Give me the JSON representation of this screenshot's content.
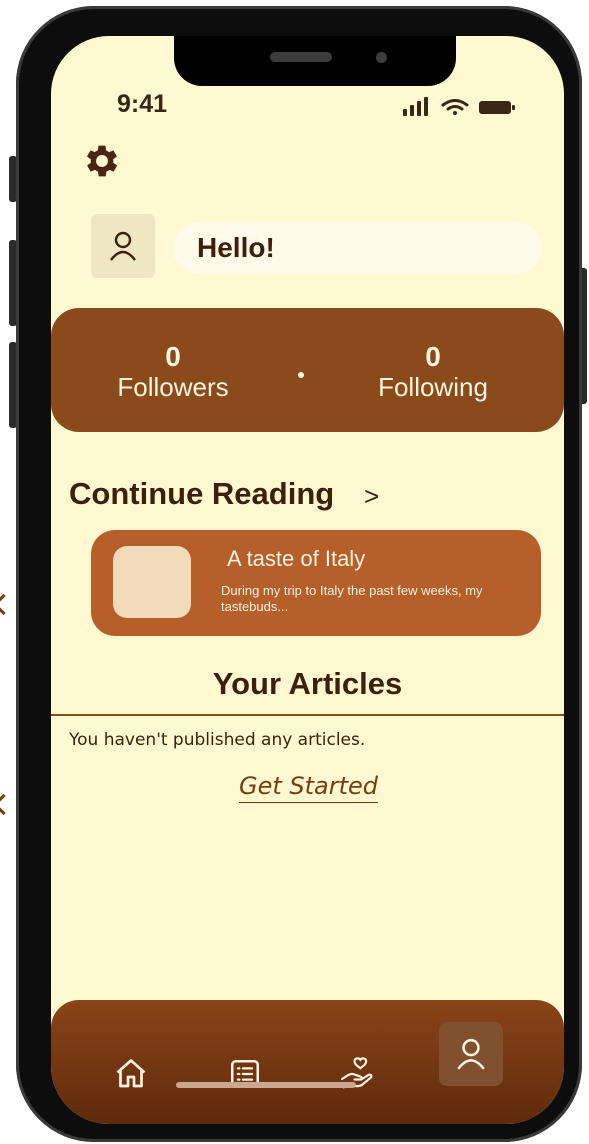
{
  "status_bar": {
    "time": "9:41"
  },
  "profile": {
    "greeting": "Hello!"
  },
  "stats": {
    "followers": {
      "count": "0",
      "label": "Followers"
    },
    "following": {
      "count": "0",
      "label": "Following"
    }
  },
  "continue_reading": {
    "title": "Continue Reading",
    "chevron": ">",
    "card": {
      "title": "A taste of Italy",
      "excerpt": "During my trip to Italy the past few weeks, my tastebuds..."
    }
  },
  "your_articles": {
    "title": "Your Articles",
    "empty_message": "You haven't published any articles.",
    "cta": "Get Started"
  },
  "bottom_nav": {
    "items": [
      {
        "icon": "home-icon",
        "active": false
      },
      {
        "icon": "list-icon",
        "active": false
      },
      {
        "icon": "heart-hand-icon",
        "active": false
      },
      {
        "icon": "user-icon",
        "active": true
      }
    ]
  },
  "colors": {
    "background": "#fef9d0",
    "brown_dark": "#8a4a1c",
    "card": "#b65f2b",
    "text": "#3d1f0b"
  }
}
